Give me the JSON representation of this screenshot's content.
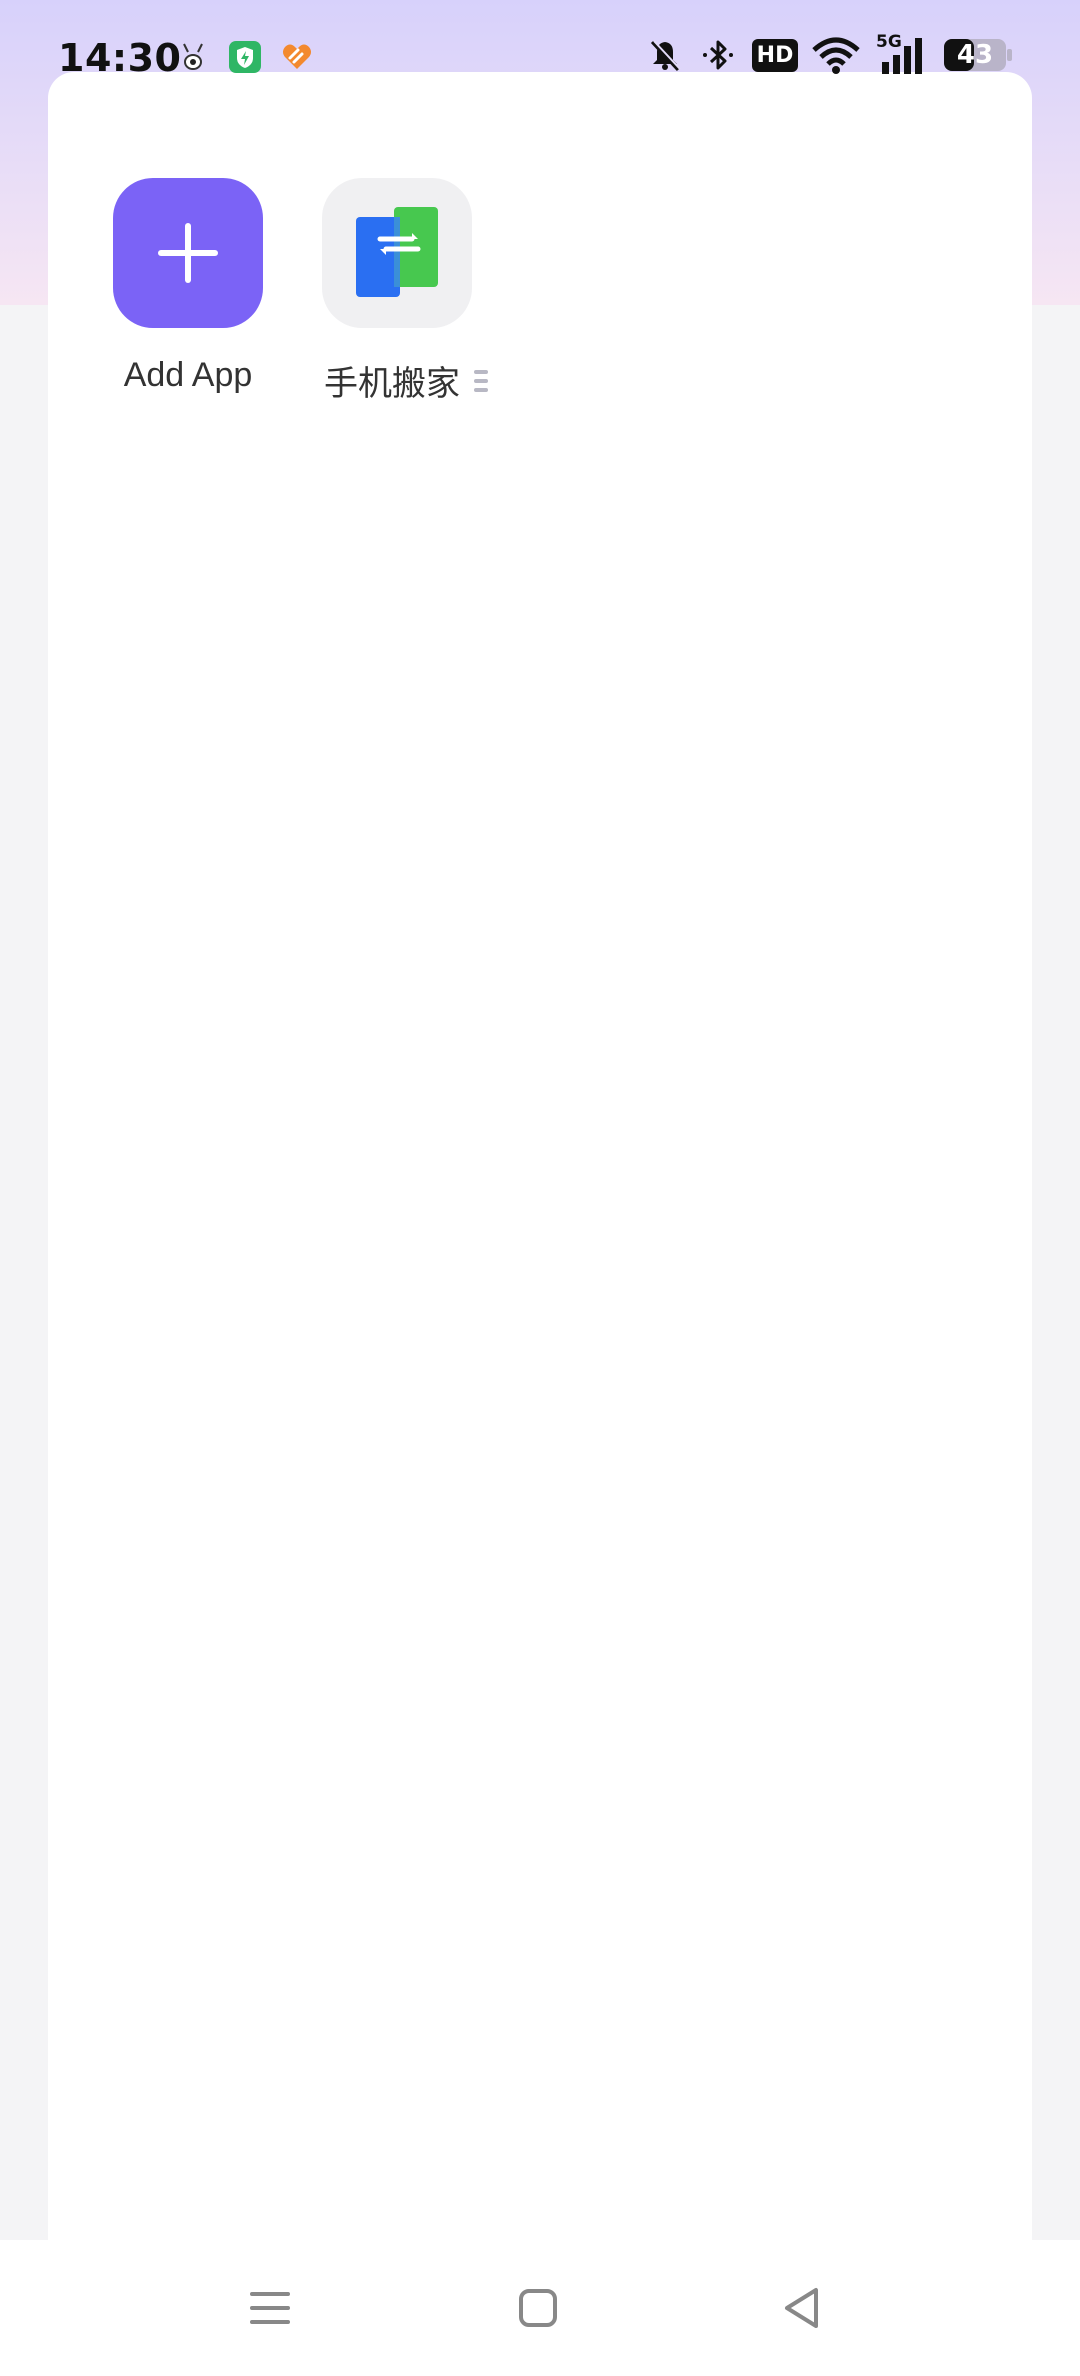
{
  "status_bar": {
    "time": "14:30",
    "notification_icons": [
      "bug-icon",
      "battery-saver-icon",
      "health-app-icon"
    ],
    "right_icons": [
      "bell-muted-icon",
      "bluetooth-icon",
      "hd-icon",
      "wifi-icon",
      "5g-signal-icon",
      "battery-icon"
    ],
    "hd_label": "HD",
    "network_label": "5G",
    "battery_level": "43"
  },
  "apps": [
    {
      "label": "Add App",
      "icon": "plus-icon",
      "color": "#7b63f6"
    },
    {
      "label": "手机搬家",
      "icon": "phone-clone-icon",
      "color": "#f0f0f2"
    }
  ],
  "nav_bar": {
    "buttons": [
      "menu-icon",
      "home-icon",
      "back-icon"
    ]
  }
}
